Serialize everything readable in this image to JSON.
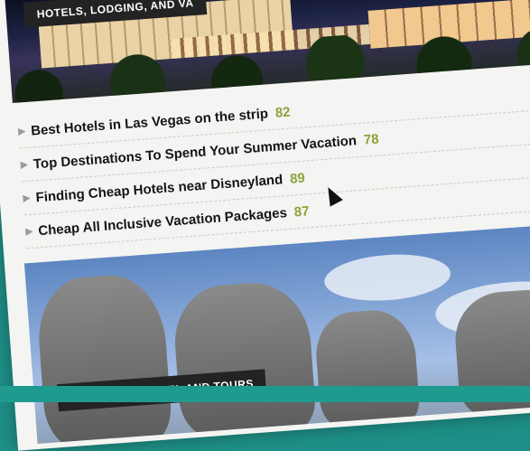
{
  "hero": {
    "label": "HOTELS, LODGING, AND VA"
  },
  "articles": [
    {
      "title": "Best Hotels in Las Vegas on the strip",
      "score": "82"
    },
    {
      "title": "Top Destinations To Spend Your Summer Vacation",
      "score": "78"
    },
    {
      "title": "Finding Cheap Hotels near Disneyland",
      "score": "89"
    },
    {
      "title": "Cheap All Inclusive Vacation Packages",
      "score": "87"
    }
  ],
  "photo": {
    "label": "SPECIALTY TRAVEL AND TOURS"
  }
}
